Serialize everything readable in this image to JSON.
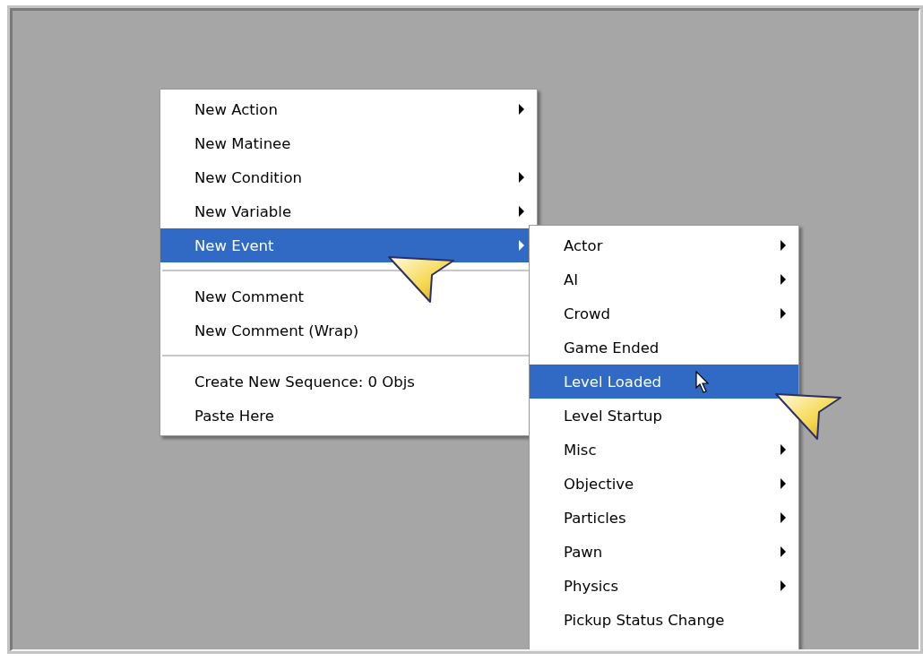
{
  "context_menu": {
    "items": [
      {
        "kind": "item",
        "label": "New Action",
        "has_submenu": true,
        "selected": false
      },
      {
        "kind": "item",
        "label": "New Matinee",
        "has_submenu": false,
        "selected": false
      },
      {
        "kind": "item",
        "label": "New Condition",
        "has_submenu": true,
        "selected": false
      },
      {
        "kind": "item",
        "label": "New Variable",
        "has_submenu": true,
        "selected": false
      },
      {
        "kind": "item",
        "label": "New Event",
        "has_submenu": true,
        "selected": true
      },
      {
        "kind": "separator"
      },
      {
        "kind": "item",
        "label": "New Comment",
        "has_submenu": false,
        "selected": false
      },
      {
        "kind": "item",
        "label": "New Comment (Wrap)",
        "has_submenu": false,
        "selected": false
      },
      {
        "kind": "separator"
      },
      {
        "kind": "item",
        "label": "Create New Sequence: 0 Objs",
        "has_submenu": false,
        "selected": false
      },
      {
        "kind": "item",
        "label": "Paste Here",
        "has_submenu": false,
        "selected": false
      }
    ]
  },
  "submenu": {
    "items": [
      {
        "kind": "item",
        "label": "Actor",
        "has_submenu": true,
        "selected": false
      },
      {
        "kind": "item",
        "label": "AI",
        "has_submenu": true,
        "selected": false
      },
      {
        "kind": "item",
        "label": "Crowd",
        "has_submenu": true,
        "selected": false
      },
      {
        "kind": "item",
        "label": "Game Ended",
        "has_submenu": false,
        "selected": false
      },
      {
        "kind": "item",
        "label": "Level Loaded",
        "has_submenu": false,
        "selected": true
      },
      {
        "kind": "item",
        "label": "Level Startup",
        "has_submenu": false,
        "selected": false
      },
      {
        "kind": "item",
        "label": "Misc",
        "has_submenu": true,
        "selected": false
      },
      {
        "kind": "item",
        "label": "Objective",
        "has_submenu": true,
        "selected": false
      },
      {
        "kind": "item",
        "label": "Particles",
        "has_submenu": true,
        "selected": false
      },
      {
        "kind": "item",
        "label": "Pawn",
        "has_submenu": true,
        "selected": false
      },
      {
        "kind": "item",
        "label": "Physics",
        "has_submenu": true,
        "selected": false
      },
      {
        "kind": "item",
        "label": "Pickup Status Change",
        "has_submenu": false,
        "selected": false
      }
    ]
  }
}
